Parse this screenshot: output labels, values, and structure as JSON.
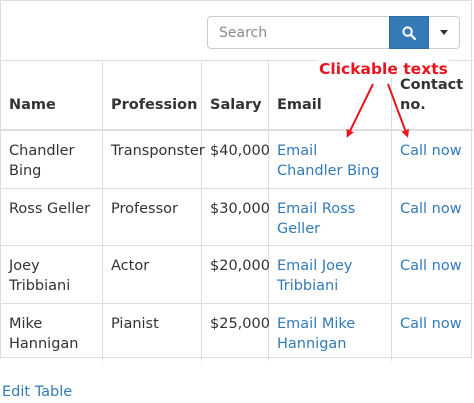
{
  "search": {
    "placeholder": "Search"
  },
  "icons": {
    "search": "magnifier-icon",
    "dropdown": "caret-down-icon"
  },
  "colors": {
    "accent": "#337ab7",
    "annotation": "#e8141e",
    "border": "#dddddd"
  },
  "table": {
    "headers": {
      "name": "Name",
      "profession": "Profession",
      "salary": "Salary",
      "email": "Email",
      "contact": "Contact no."
    },
    "rows": [
      {
        "name": "Chandler Bing",
        "profession": "Transponster",
        "salary": "$40,000",
        "email": "Email Chandler Bing",
        "contact": "Call now"
      },
      {
        "name": "Ross Geller",
        "profession": "Professor",
        "salary": "$30,000",
        "email": "Email Ross Geller",
        "contact": "Call now"
      },
      {
        "name": "Joey Tribbiani",
        "profession": "Actor",
        "salary": "$20,000",
        "email": "Email Joey Tribbiani",
        "contact": "Call now"
      },
      {
        "name": "Mike Hannigan",
        "profession": "Pianist",
        "salary": "$25,000",
        "email": "Email Mike Hannigan",
        "contact": "Call now"
      }
    ]
  },
  "edit_link": "Edit Table",
  "annotation": "Clickable texts"
}
